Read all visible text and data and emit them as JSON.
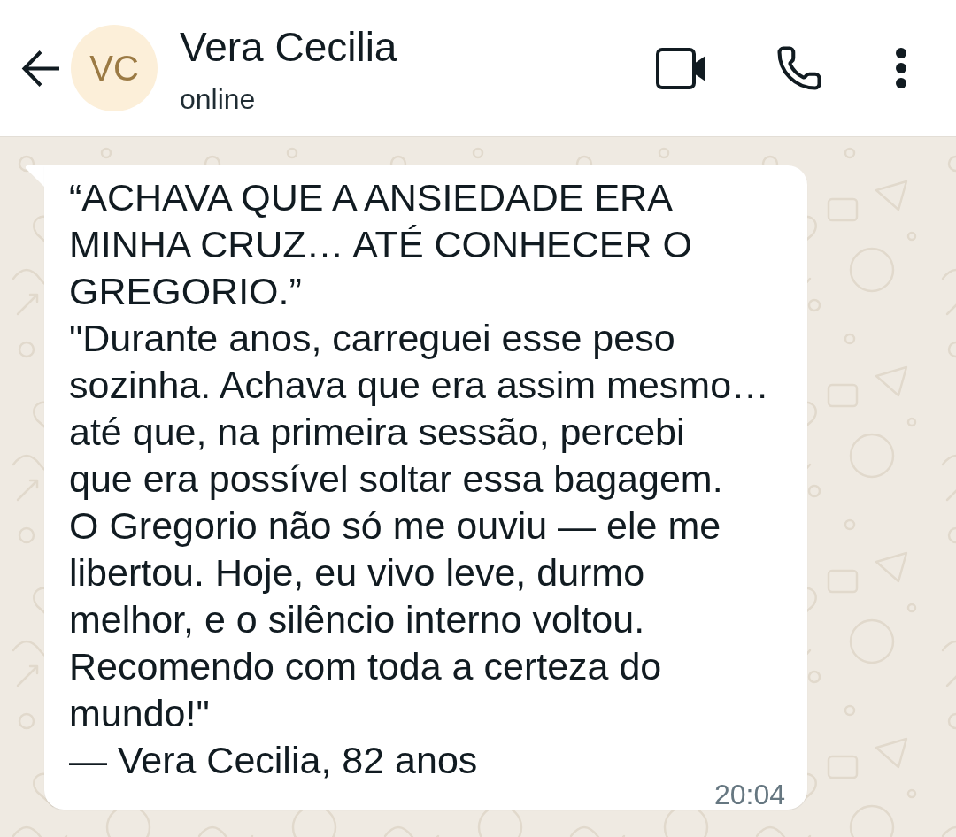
{
  "header": {
    "avatar_initials": "VC",
    "name": "Vera Cecilia",
    "status": "online"
  },
  "messages": [
    {
      "kind": "incoming",
      "lines": [
        "“ACHAVA QUE A ANSIEDADE ERA",
        "MINHA CRUZ… ATÉ CONHECER O",
        "GREGORIO.”",
        "\"Durante anos, carreguei esse peso",
        "sozinha. Achava que era assim mesmo…",
        "até que, na primeira sessão, percebi",
        "que era possível soltar essa bagagem.",
        "O Gregorio não só me ouviu — ele me",
        "libertou. Hoje, eu vivo leve, durmo",
        "melhor, e o silêncio interno voltou.",
        "Recomendo com toda a certeza do",
        "mundo!\"",
        "— Vera Cecilia, 82 anos"
      ],
      "time": "20:04"
    }
  ]
}
